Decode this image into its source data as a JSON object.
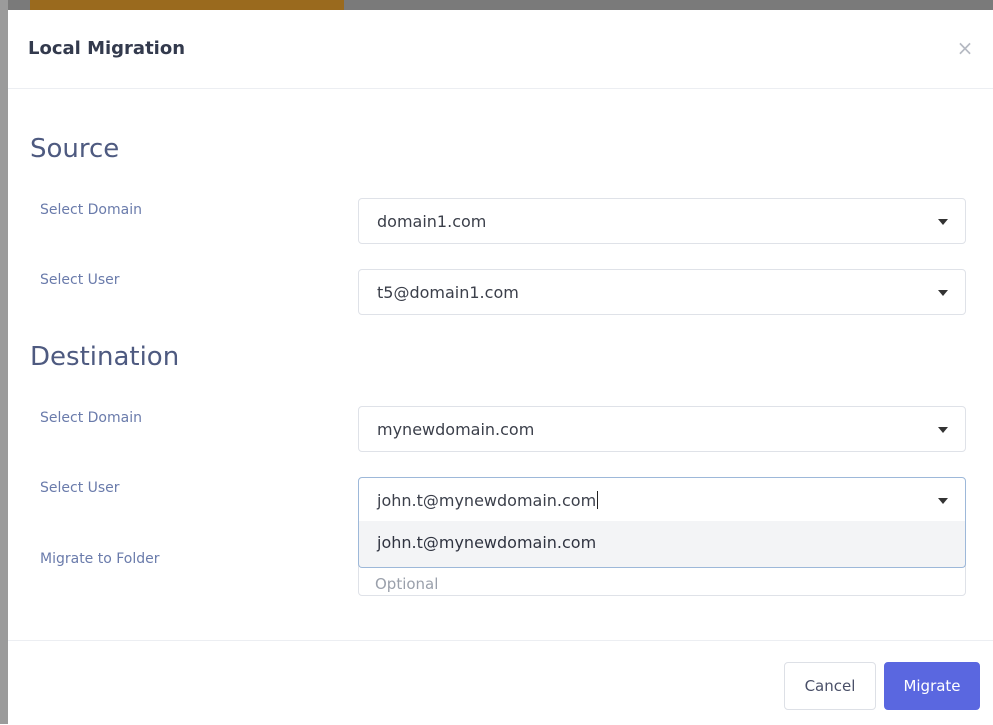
{
  "modal": {
    "title": "Local Migration",
    "close_glyph": "×"
  },
  "source": {
    "heading": "Source",
    "domain_label": "Select Domain",
    "domain_value": "domain1.com",
    "user_label": "Select User",
    "user_value": "t5@domain1.com"
  },
  "destination": {
    "heading": "Destination",
    "domain_label": "Select Domain",
    "domain_value": "mynewdomain.com",
    "user_label": "Select User",
    "user_value": "john.t@mynewdomain.com",
    "user_dropdown_options": [
      "john.t@mynewdomain.com"
    ],
    "folder_label": "Migrate to Folder",
    "folder_placeholder": "Optional"
  },
  "footer": {
    "cancel_label": "Cancel",
    "migrate_label": "Migrate"
  },
  "colors": {
    "accent_primary": "#5a67e0",
    "heading_color": "#4e5a80",
    "label_color": "#6a7bab"
  }
}
